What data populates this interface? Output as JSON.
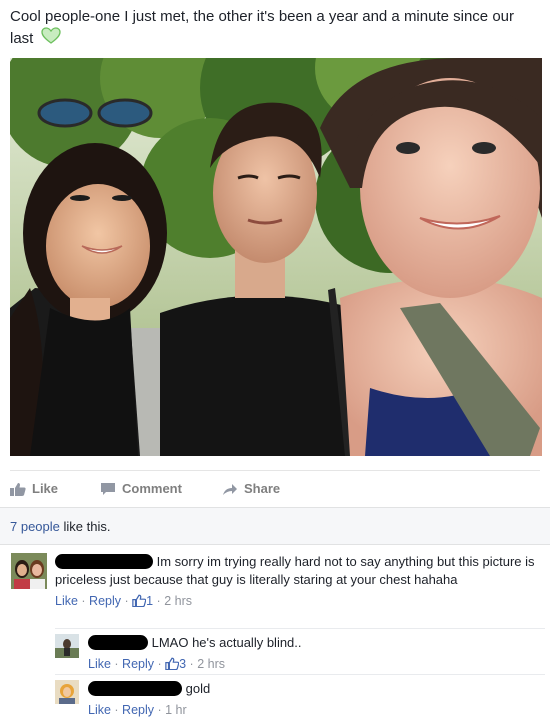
{
  "post": {
    "text": "Cool people-one I just met, the other it's been a year and a minute since our last"
  },
  "actions": {
    "like": "Like",
    "comment": "Comment",
    "share": "Share"
  },
  "likes": {
    "count_text": "7 people",
    "suffix": "like this."
  },
  "comments": [
    {
      "text": "Im sorry im trying really hard not to say anything but this picture is priceless just because that guy is literally staring at your chest hahaha",
      "like_label": "Like",
      "reply_label": "Reply",
      "reactions": "1",
      "time": "2 hrs"
    },
    {
      "text": "LMAO he's actually blind..",
      "like_label": "Like",
      "reply_label": "Reply",
      "reactions": "3",
      "time": "2 hrs"
    },
    {
      "text": "gold",
      "like_label": "Like",
      "reply_label": "Reply",
      "time": "1 hr"
    }
  ],
  "colors": {
    "link_blue": "#365899",
    "meta_gray": "#90949c",
    "action_gray": "#7f7f7f"
  }
}
